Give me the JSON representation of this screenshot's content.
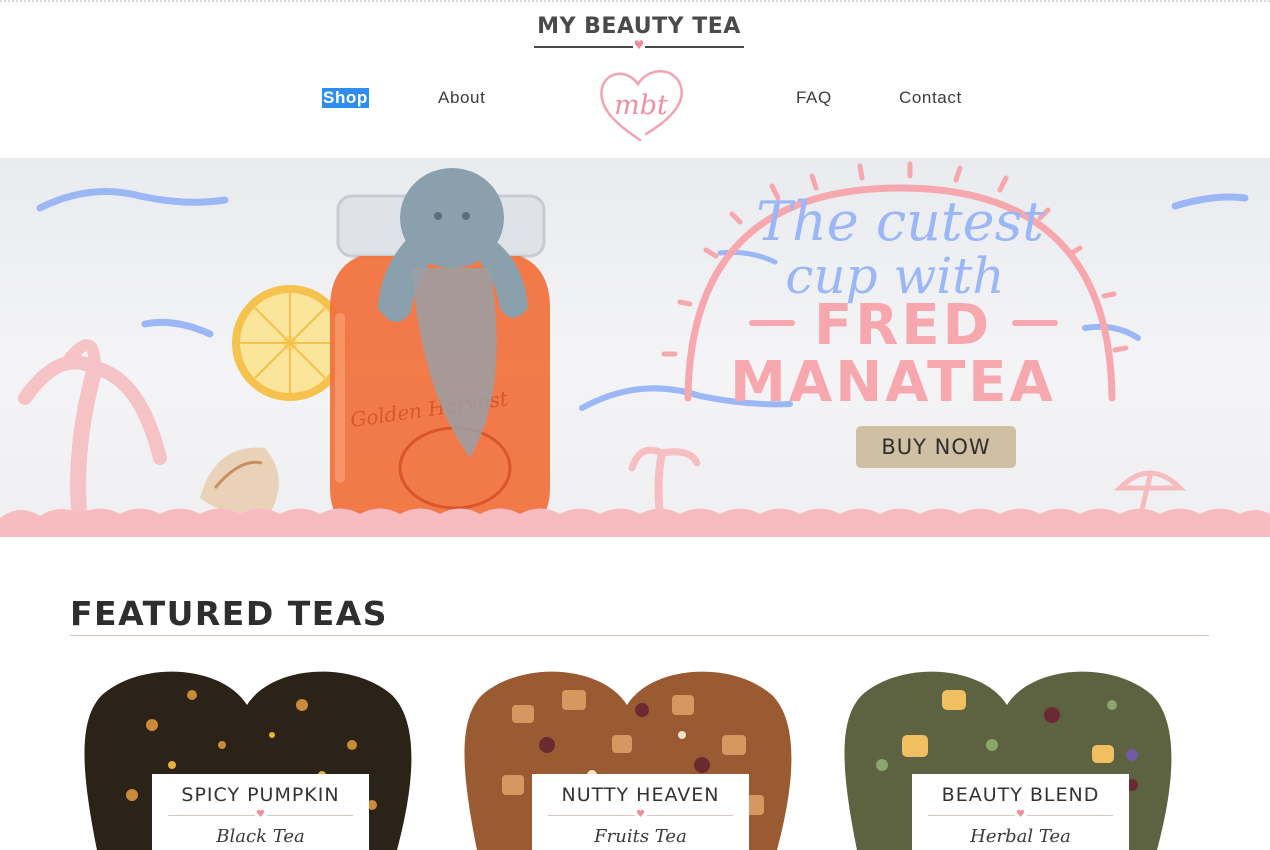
{
  "brand": {
    "name": "MY BEAUTY TEA",
    "monogram": "mbt"
  },
  "nav": {
    "left": [
      {
        "label": "Shop",
        "active": true
      },
      {
        "label": "About",
        "active": false
      }
    ],
    "right": [
      {
        "label": "FAQ",
        "active": false
      },
      {
        "label": "Contact",
        "active": false
      }
    ]
  },
  "hero": {
    "script_line1": "The cutest",
    "script_line2": "cup with",
    "headline1": "FRED",
    "headline2": "MANATEA",
    "button": "BUY NOW",
    "jar_text": "Golden Harvest"
  },
  "featured": {
    "title": "FEATURED TEAS",
    "items": [
      {
        "name": "SPICY PUMPKIN",
        "type": "Black Tea"
      },
      {
        "name": "NUTTY HEAVEN",
        "type": "Fruits Tea"
      },
      {
        "name": "BEAUTY BLEND",
        "type": "Herbal Tea"
      }
    ]
  },
  "colors": {
    "accent_pink": "#f6a8ae",
    "accent_blue": "#9bb7f5",
    "button_tan": "#cfbfa3",
    "active_nav": "#2f8df0"
  },
  "icons": [
    "heart-icon",
    "palm-tree-icon",
    "umbrella-icon",
    "sun-icon"
  ]
}
